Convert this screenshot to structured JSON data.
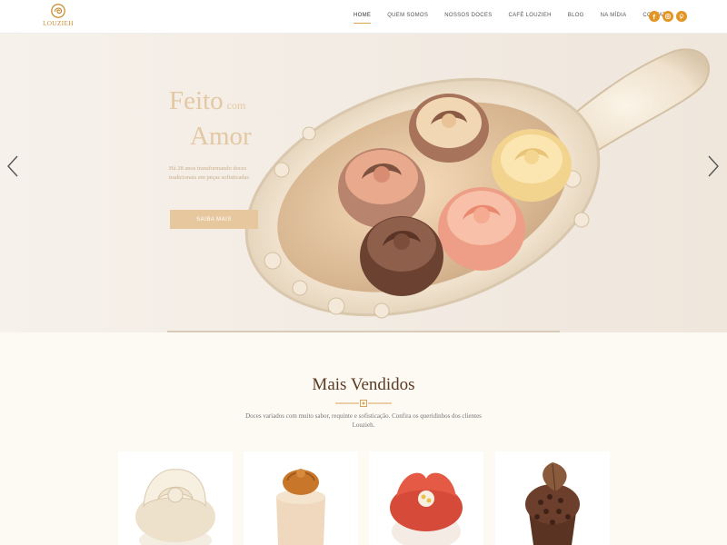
{
  "brand": {
    "name": "LOUZIEH"
  },
  "nav": {
    "items": [
      {
        "label": "HOME",
        "active": true
      },
      {
        "label": "QUEM SOMOS"
      },
      {
        "label": "NOSSOS DOCES"
      },
      {
        "label": "CAFÉ LOUZIEH"
      },
      {
        "label": "BLOG"
      },
      {
        "label": "NA MÍDIA"
      },
      {
        "label": "CONTATO"
      }
    ]
  },
  "social": [
    {
      "icon": "facebook-icon"
    },
    {
      "icon": "instagram-icon"
    },
    {
      "icon": "pinterest-icon"
    }
  ],
  "hero": {
    "title_word1": "Feito",
    "title_word2": "com",
    "title_word3": "Amor",
    "subtitle": "Há 28 anos transformando doces tradicionais em peças sofisticadas",
    "button_label": "SAIBA MAIS"
  },
  "bestsellers": {
    "title": "Mais Vendidos",
    "description": "Doces variados com muito sabor, requinte e sofisticação. Confira os queridinhos dos clientes Louzieh.",
    "products": [
      {
        "icon": "white-rose-sweet"
      },
      {
        "icon": "caramel-cupcake-sweet"
      },
      {
        "icon": "red-flower-sweet"
      },
      {
        "icon": "chocolate-leaf-sweet"
      }
    ]
  },
  "colors": {
    "accent": "#e39524",
    "hero_text": "#e3c8a3",
    "button": "#e7c89e",
    "section_bg": "#fdf9f3",
    "title_brown": "#5a3b24"
  }
}
